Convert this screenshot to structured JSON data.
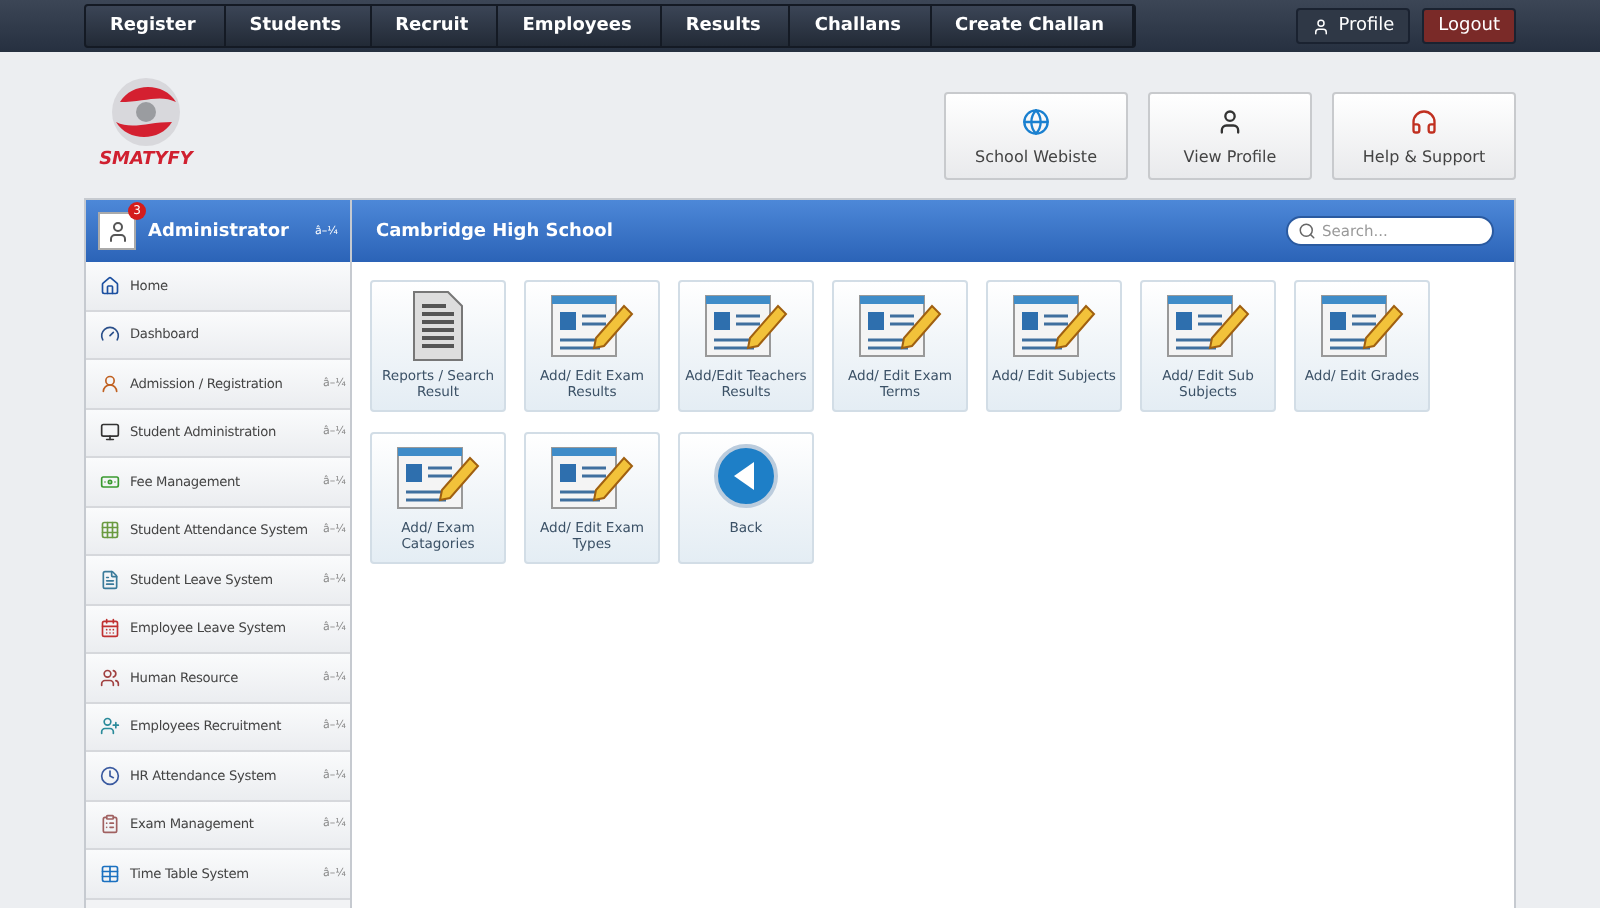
{
  "top_nav": {
    "crumbs": [
      "Register",
      "Students",
      "Recruit",
      "Employees",
      "Results",
      "Challans",
      "Create Challan"
    ],
    "profile": "Profile",
    "logout": "Logout"
  },
  "logo": {
    "text": "SMATYFY"
  },
  "header_buttons": [
    "School Webiste",
    "View Profile",
    "Help & Support"
  ],
  "sidebar": {
    "title": "Administrator",
    "badge": "3",
    "caret": "â–¼",
    "items": [
      {
        "label": "Home"
      },
      {
        "label": "Dashboard"
      },
      {
        "label": "Admission / Registration",
        "caret": "â–¼"
      },
      {
        "label": "Student Administration",
        "caret": "â–¼"
      },
      {
        "label": "Fee Management",
        "caret": "â–¼"
      },
      {
        "label": "Student Attendance System",
        "caret": "â–¼"
      },
      {
        "label": "Student Leave System",
        "caret": "â–¼"
      },
      {
        "label": "Employee Leave System",
        "caret": "â–¼"
      },
      {
        "label": "Human Resource",
        "caret": "â–¼"
      },
      {
        "label": "Employees Recruitment",
        "caret": "â–¼"
      },
      {
        "label": "HR Attendance System",
        "caret": "â–¼"
      },
      {
        "label": "Exam Management",
        "caret": "â–¼"
      },
      {
        "label": "Time Table System",
        "caret": "â–¼"
      }
    ]
  },
  "panel": {
    "title": "Cambridge High School",
    "search": {
      "placeholder": "Search..."
    },
    "tiles": [
      {
        "kind": "document",
        "label": "Reports / Search Result"
      },
      {
        "kind": "form",
        "label": "Add/ Edit Exam Results"
      },
      {
        "kind": "form",
        "label": "Add/Edit Teachers Results"
      },
      {
        "kind": "form",
        "label": "Add/ Edit Exam Terms"
      },
      {
        "kind": "form",
        "label": "Add/ Edit Subjects"
      },
      {
        "kind": "form",
        "label": "Add/ Edit Sub Subjects"
      },
      {
        "kind": "form",
        "label": "Add/ Edit Grades"
      },
      {
        "kind": "form",
        "label": "Add/ Exam Catagories"
      },
      {
        "kind": "form",
        "label": "Add/ Edit Exam Types"
      },
      {
        "kind": "back",
        "label": "Back"
      }
    ]
  }
}
